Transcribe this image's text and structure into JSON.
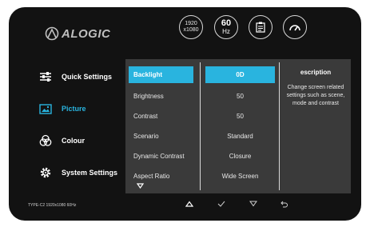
{
  "brand": {
    "logo_text": "ALOGIC"
  },
  "header": {
    "resolution_top": "1920",
    "resolution_bottom": "x1080",
    "refresh_value": "60",
    "refresh_unit": "Hz"
  },
  "sidebar": {
    "items": [
      {
        "label": "Quick Settings"
      },
      {
        "label": "Picture"
      },
      {
        "label": "Colour"
      },
      {
        "label": "System Settings"
      }
    ]
  },
  "settings": {
    "items": [
      {
        "label": "Backlight",
        "value": "0D"
      },
      {
        "label": "Brightness",
        "value": "50"
      },
      {
        "label": "Contrast",
        "value": "50"
      },
      {
        "label": "Scenario",
        "value": "Standard"
      },
      {
        "label": "Dynamic Contrast",
        "value": "Closure"
      },
      {
        "label": "Aspect Ratio",
        "value": "Wide Screen"
      }
    ]
  },
  "description": {
    "title": "escription",
    "text": "Change screen related settings such as scene, mode and contrast"
  },
  "footer": {
    "status": "TYPE-C2  1920x1080 60Hz"
  },
  "colors": {
    "accent": "#29b4df",
    "background": "#121212",
    "panel": "#3a3a3a"
  },
  "icons": [
    "logo-icon",
    "checklist-icon",
    "speedometer-icon",
    "sliders-icon",
    "picture-icon",
    "palette-icon",
    "gear-icon",
    "down-arrow-icon",
    "nav-up-icon",
    "nav-confirm-icon",
    "nav-down-icon",
    "nav-back-icon"
  ]
}
